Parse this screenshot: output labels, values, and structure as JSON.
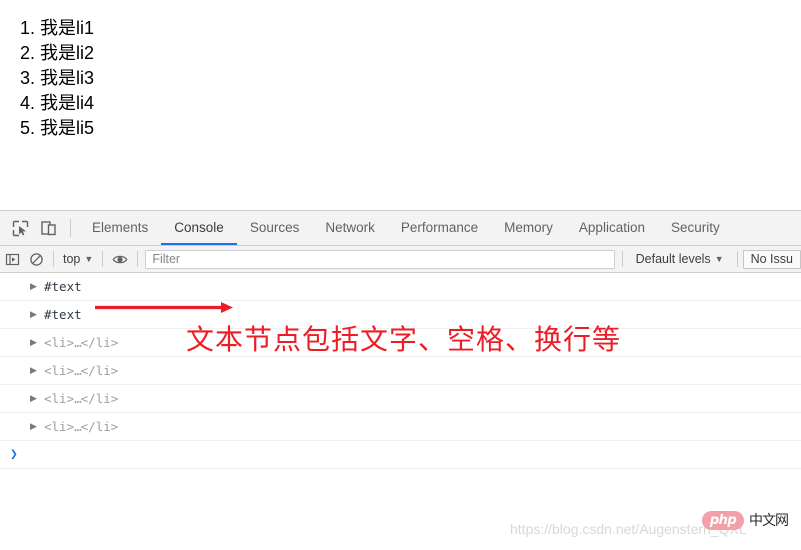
{
  "page": {
    "list_items": [
      "我是li1",
      "我是li2",
      "我是li3",
      "我是li4",
      "我是li5"
    ]
  },
  "devtools": {
    "toolbar_icons": [
      {
        "name": "inspect-element-icon",
        "title": "Inspect element"
      },
      {
        "name": "device-toolbar-icon",
        "title": "Toggle device toolbar"
      }
    ],
    "tabs": [
      {
        "label": "Elements",
        "active": false
      },
      {
        "label": "Console",
        "active": true
      },
      {
        "label": "Sources",
        "active": false
      },
      {
        "label": "Network",
        "active": false
      },
      {
        "label": "Performance",
        "active": false
      },
      {
        "label": "Memory",
        "active": false
      },
      {
        "label": "Application",
        "active": false
      },
      {
        "label": "Security",
        "active": false
      }
    ],
    "active_tab": "Console",
    "accent_color": "#1a73e8",
    "console_toolbar": {
      "sidebar_toggle_icon": "console-sidebar-icon",
      "clear_icon": "clear-console-icon",
      "context_selector": {
        "label": "top",
        "caret": "▼"
      },
      "eye_icon": "live-expression-icon",
      "filter_placeholder": "Filter",
      "filter_value": "",
      "levels_selector": {
        "label": "Default levels",
        "caret": "▼"
      },
      "issues_button": "No Issu"
    },
    "console_rows": [
      {
        "type": "text-node",
        "expander": "▶",
        "label": "#text"
      },
      {
        "type": "text-node",
        "expander": "▶",
        "label": "#text"
      },
      {
        "type": "element",
        "expander": "▶",
        "open": "<li>",
        "dots": "…",
        "close": "</li>"
      },
      {
        "type": "element",
        "expander": "▶",
        "open": "<li>",
        "dots": "…",
        "close": "</li>"
      },
      {
        "type": "element",
        "expander": "▶",
        "open": "<li>",
        "dots": "…",
        "close": "</li>"
      },
      {
        "type": "element",
        "expander": "▶",
        "open": "<li>",
        "dots": "…",
        "close": "</li>"
      }
    ],
    "prompt_caret": "❯"
  },
  "annotations": {
    "arrow_color": "#ee1c25",
    "note_text": "文本节点包括文字、空格、换行等"
  },
  "watermarks": {
    "blog_url": "https://blog.csdn.net/Augenstern_QXL",
    "php_badge": "php",
    "php_site": "中文网"
  }
}
